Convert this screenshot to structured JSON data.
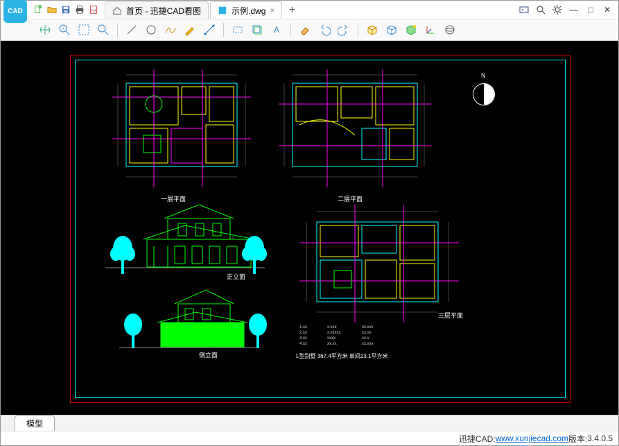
{
  "app": {
    "logo_text": "CAD"
  },
  "quick": {
    "new": "new",
    "open": "open",
    "save": "save",
    "print": "print",
    "pdf": "pdf"
  },
  "tabs": {
    "home": {
      "label": "首页 - 迅捷CAD看图"
    },
    "file": {
      "label": "示例.dwg",
      "close": "×"
    },
    "add": "+"
  },
  "window": {
    "min": "—",
    "max": "□",
    "close": "✕"
  },
  "syscfg": {
    "screen": "screen",
    "zoom": "zoom",
    "gear": "settings"
  },
  "toolbar": {
    "grp1": [
      "pan",
      "zoom-extent",
      "zoom-window",
      "zoom-prev"
    ],
    "grp2": [
      "point",
      "circle",
      "polyline",
      "arc",
      "line"
    ],
    "grp3": [
      "rect",
      "layer",
      "text"
    ],
    "grp4": [
      "erase",
      "undo",
      "redo"
    ],
    "grp5": [
      "box3d",
      "3d",
      "sphere",
      "axis",
      "orbit"
    ]
  },
  "drawing": {
    "plan1_caption": "一层平面",
    "plan2_caption": "二层平面",
    "plan3_caption": "三层平面",
    "elev1_caption": "正立面",
    "elev2_caption": "侧立面",
    "compass_n": "N",
    "note_title": "L型别墅  367.4平方米  单间23.1平方米"
  },
  "model_tab": "模型",
  "footer": {
    "brand": "迅捷CAD: ",
    "url": "www.xunjiecad.com",
    "ver_label": " 版本: ",
    "ver": "3.4.0.5"
  }
}
